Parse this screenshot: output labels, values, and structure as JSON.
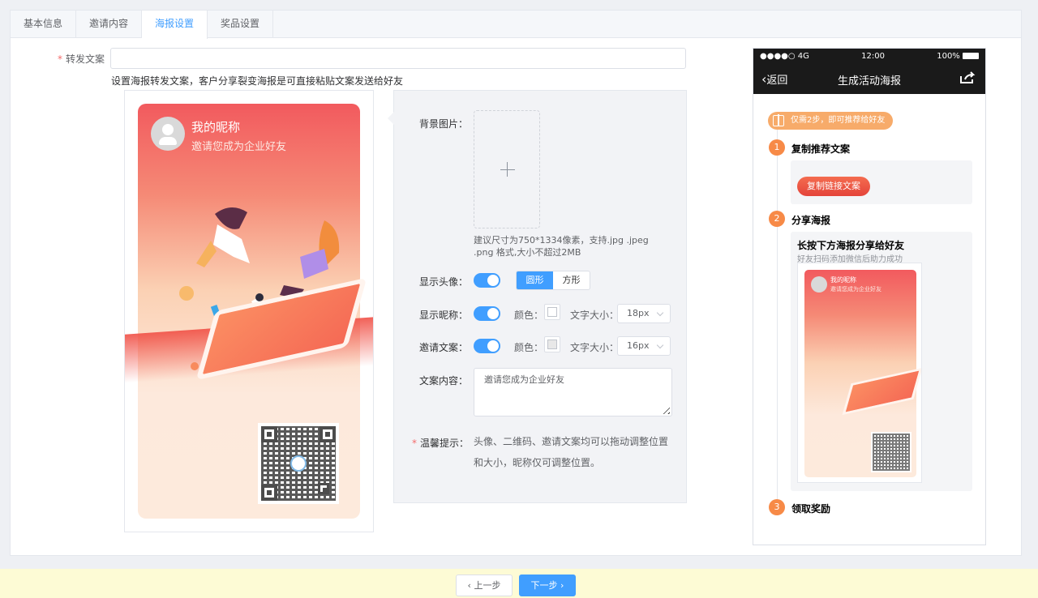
{
  "tabs": [
    {
      "label": "基本信息"
    },
    {
      "label": "邀请内容"
    },
    {
      "label": "海报设置"
    },
    {
      "label": "奖品设置"
    }
  ],
  "active_tab": 2,
  "forward": {
    "label": "转发文案",
    "value": "",
    "hint": "设置海报转发文案，客户分享裂变海报是可直接粘贴文案发送给好友"
  },
  "poster": {
    "nickname": "我的昵称",
    "invite_text": "邀请您成为企业好友"
  },
  "settings": {
    "bg_label": "背景图片：",
    "upload_tip": "建议尺寸为750*1334像素，支持.jpg .jpeg .png 格式,大小不超过2MB",
    "show_avatar_label": "显示头像：",
    "shape_round": "圆形",
    "shape_square": "方形",
    "show_nick_label": "显示昵称：",
    "invite_label": "邀请文案：",
    "color_label": "颜色：",
    "font_size_label": "文字大小：",
    "nick_font_size": "18px",
    "invite_font_size": "16px",
    "nick_color": "#ffffff",
    "invite_color": "#e8e8e8",
    "content_label": "文案内容：",
    "content_value": "邀请您成为企业好友",
    "tips_label": "温馨提示：",
    "tips_text": "头像、二维码、邀请文案均可以拖动调整位置和大小，昵称仅可调整位置。",
    "show_avatar": true,
    "show_nick": true,
    "show_invite": true
  },
  "mobile": {
    "signal": "●●●●○ 4G",
    "time": "12:00",
    "battery": "100%",
    "back": "返回",
    "title": "生成活动海报",
    "badge": "仅需2步，即可推荐给好友",
    "step1_no": "1",
    "step1": "复制推荐文案",
    "copy_btn": "复制链接文案",
    "step2_no": "2",
    "step2": "分享海报",
    "share_title": "长按下方海报分享给好友",
    "share_sub": "好友扫码添加微信后助力成功",
    "mini_nick": "我的昵称",
    "mini_invite": "邀请您成为企业好友",
    "step3_no": "3",
    "step3": "领取奖励"
  },
  "footer": {
    "prev": "上一步",
    "next": "下一步"
  },
  "colors": {
    "primary": "#409eff",
    "accent_orange": "#f78a47",
    "footer_bg": "#fdfbd5"
  }
}
